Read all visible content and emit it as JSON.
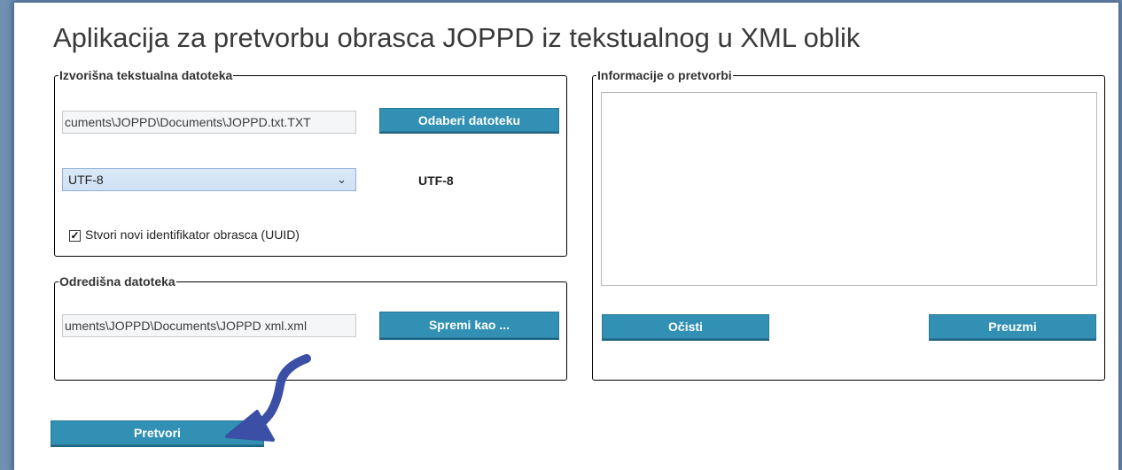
{
  "window": {
    "title": "Aplikacija za pretvorbu obrasca JOPPD iz tekstualnog u XML oblik"
  },
  "source_group": {
    "legend": "Izvorišna tekstualna datoteka",
    "file_path": "cuments\\JOPPD\\Documents\\JOPPD.txt.TXT",
    "choose_button": "Odaberi datoteku",
    "encoding_selected": "UTF-8",
    "encoding_display": "UTF-8",
    "uuid_checkbox_label": "Stvori novi identifikator obrasca (UUID)",
    "uuid_checked": true
  },
  "destination_group": {
    "legend": "Odredišna datoteka",
    "file_path": "uments\\JOPPD\\Documents\\JOPPD xml.xml",
    "save_as_button": "Spremi kao ..."
  },
  "info_group": {
    "legend": "Informacije o pretvorbi",
    "log_text": "",
    "clear_button": "Očisti",
    "download_button": "Preuzmi"
  },
  "convert_button": "Pretvori",
  "annotation": {
    "arrow_color": "#3b4fa6"
  }
}
